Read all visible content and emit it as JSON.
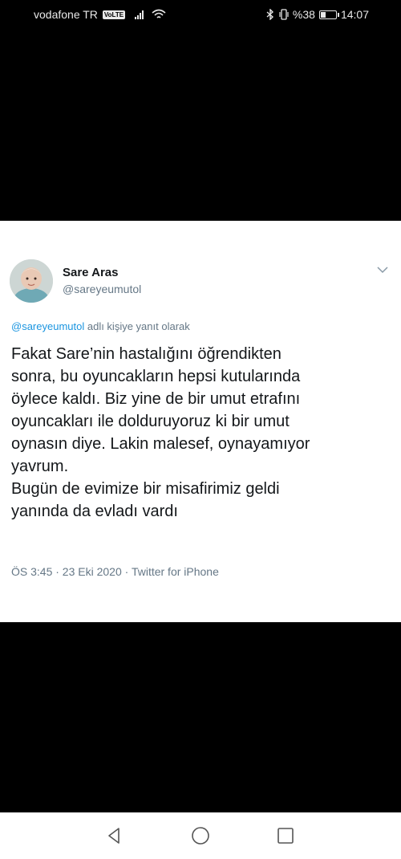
{
  "status_bar": {
    "carrier": "vodafone TR",
    "network_badge": "VoLTE",
    "battery_text": "%38",
    "battery_level": 0.38,
    "time": "14:07",
    "icons": [
      "signal-icon",
      "wifi-icon",
      "bluetooth-icon",
      "vibrate-icon",
      "battery-icon"
    ]
  },
  "tweet": {
    "display_name": "Sare Aras",
    "handle": "@sareyeumutol",
    "reply_to_mention": "@sareyeumutol",
    "reply_to_suffix": " adlı kişiye yanıt olarak",
    "body_lines": [
      "Fakat Sare’nin hastalığını öğrendikten",
      "sonra, bu oyuncakların hepsi kutularında",
      "öylece kaldı. Biz yine de bir umut etrafını",
      "oyuncakları ile dolduruyoruz ki bir umut",
      "oynasın diye. Lakin malesef, oynayamıyor",
      "yavrum.",
      "Bugün de evimize bir misafirimiz geldi",
      "yanında da evladı vardı"
    ],
    "meta": "ÖS 3:45 · 23 Eki 2020 · Twitter for iPhone",
    "mention_color": "#1b95e0",
    "secondary_color": "#657786",
    "text_color": "#14171a"
  },
  "nav_bar": {
    "buttons": [
      "back-icon",
      "home-icon",
      "recents-icon"
    ]
  }
}
